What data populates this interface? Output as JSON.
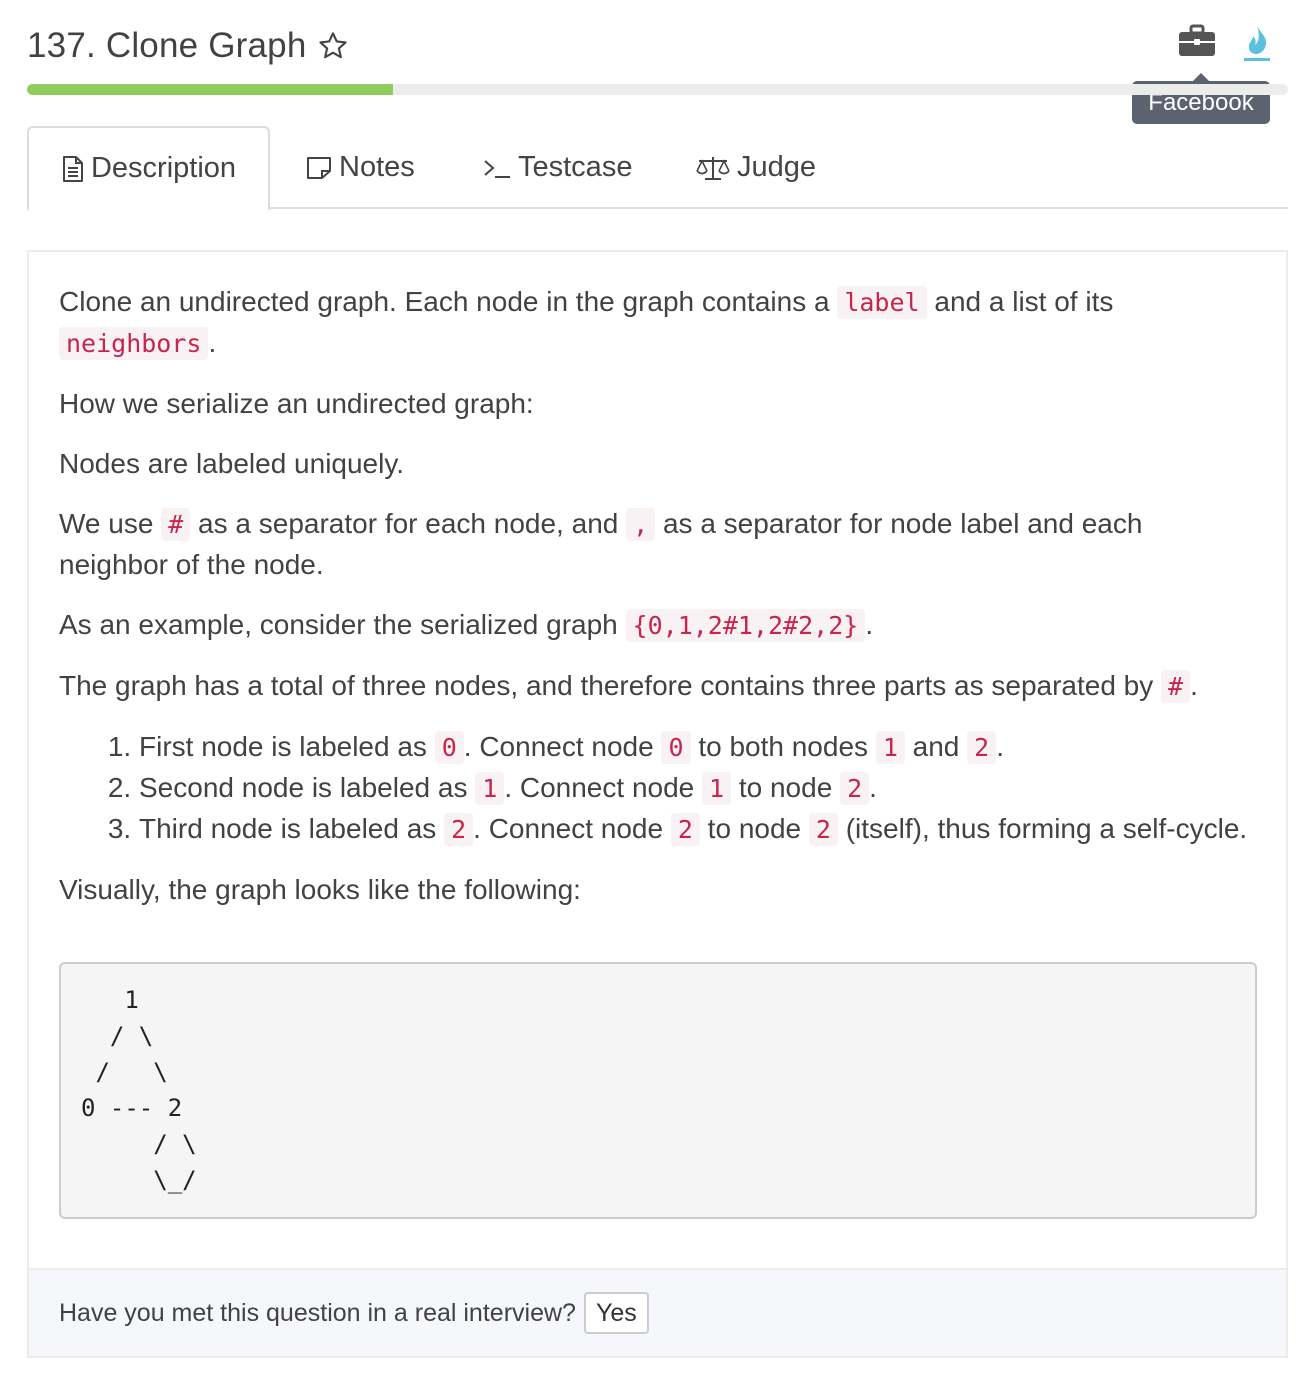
{
  "header": {
    "title": "137. Clone Graph",
    "star_icon": "star-outline-icon",
    "company_icon": "briefcase-icon",
    "fire_icon": "flame-icon",
    "tooltip": "Facebook",
    "progress": 0.29,
    "progress_color": "#8fce5c"
  },
  "tabs": [
    {
      "label": "Description",
      "icon": "document-icon",
      "active": true
    },
    {
      "label": "Notes",
      "icon": "note-icon",
      "active": false
    },
    {
      "label": "Testcase",
      "icon": "terminal-icon",
      "active": false
    },
    {
      "label": "Judge",
      "icon": "scale-icon",
      "active": false
    }
  ],
  "description": {
    "p1_a": "Clone an undirected graph. Each node in the graph contains a ",
    "p1_code1": "label",
    "p1_b": " and a list of its ",
    "p1_code2": "neighbors",
    "p1_c": ".",
    "p2": "How we serialize an undirected graph:",
    "p3": "Nodes are labeled uniquely.",
    "p4_a": "We use ",
    "p4_code1": "#",
    "p4_b": " as a separator for each node, and ",
    "p4_code2": ",",
    "p4_c": " as a separator for node label and each neighbor of the node.",
    "p5_a": "As an example, consider the serialized graph ",
    "p5_code": "{0,1,2#1,2#2,2}",
    "p5_b": ".",
    "p6_a": "The graph has a total of three nodes, and therefore contains three parts as separated by ",
    "p6_code": "#",
    "p6_b": ".",
    "steps": [
      {
        "t1": "First node is labeled as ",
        "c1": "0",
        "t2": ". Connect node ",
        "c2": "0",
        "t3": " to both nodes ",
        "c3": "1",
        "t4": " and ",
        "c4": "2",
        "t5": "."
      },
      {
        "t1": "Second node is labeled as ",
        "c1": "1",
        "t2": ". Connect node ",
        "c2": "1",
        "t3": " to node ",
        "c3": "2",
        "t4": "."
      },
      {
        "t1": "Third node is labeled as ",
        "c1": "2",
        "t2": ". Connect node ",
        "c2": "2",
        "t3": " to node ",
        "c3": "2",
        "t4": " (itself), thus forming a self-cycle."
      }
    ],
    "p7": "Visually, the graph looks like the following:",
    "graph_ascii": "   1\n  / \\\n /   \\\n0 --- 2\n     / \\\n     \\_/"
  },
  "footer": {
    "question": "Have you met this question in a real interview?",
    "yes_label": "Yes"
  }
}
